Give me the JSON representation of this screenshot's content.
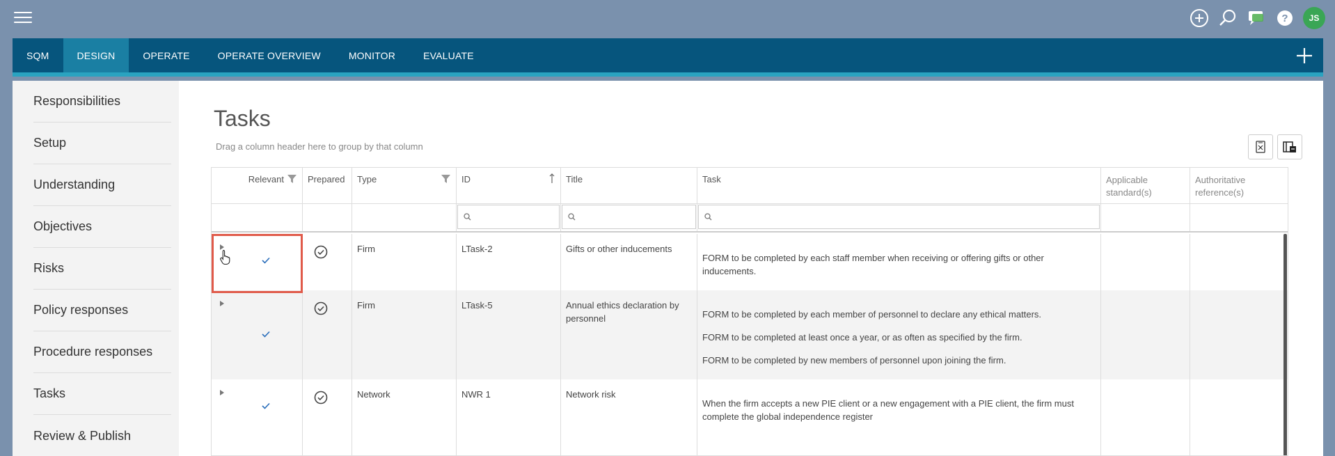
{
  "topbar": {
    "icons": [
      "plus-circle-icon",
      "search-icon",
      "chat-icon",
      "help-icon"
    ],
    "avatar_initials": "JS",
    "avatar_color": "#3aa655"
  },
  "nav": {
    "tabs": [
      {
        "label": "SQM",
        "active": false
      },
      {
        "label": "DESIGN",
        "active": true
      },
      {
        "label": "OPERATE",
        "active": false
      },
      {
        "label": "OPERATE OVERVIEW",
        "active": false
      },
      {
        "label": "MONITOR",
        "active": false
      },
      {
        "label": "EVALUATE",
        "active": false
      }
    ],
    "bar_color": "#06557d",
    "accent_color": "#2aa3c0"
  },
  "sidebar": {
    "items": [
      {
        "label": "Responsibilities"
      },
      {
        "label": "Setup"
      },
      {
        "label": "Understanding"
      },
      {
        "label": "Objectives"
      },
      {
        "label": "Risks"
      },
      {
        "label": "Policy responses"
      },
      {
        "label": "Procedure responses"
      },
      {
        "label": "Tasks"
      },
      {
        "label": "Review & Publish"
      }
    ]
  },
  "main": {
    "title": "Tasks",
    "group_hint": "Drag a column header here to group by that column"
  },
  "grid": {
    "columns": [
      {
        "label": "Relevant"
      },
      {
        "label": "Prepared"
      },
      {
        "label": "Type"
      },
      {
        "label": "ID"
      },
      {
        "label": "Title"
      },
      {
        "label": "Task"
      },
      {
        "label": "Applicable standard(s)"
      },
      {
        "label": "Authoritative reference(s)"
      }
    ],
    "rows": [
      {
        "relevant": true,
        "prepared": true,
        "type": "Firm",
        "id": "LTask-2",
        "title": "Gifts or other inducements",
        "task": [
          "FORM to be completed by each staff member when receiving or offering gifts or other inducements."
        ],
        "standards": "",
        "references": ""
      },
      {
        "relevant": true,
        "prepared": true,
        "type": "Firm",
        "id": "LTask-5",
        "title": "Annual ethics declaration by personnel",
        "task": [
          "FORM to be completed by each member of personnel to declare any ethical matters.",
          "FORM to be completed at least once a year, or as often as specified by the firm.",
          "FORM to be completed by new members of personnel upon joining the firm."
        ],
        "standards": "",
        "references": ""
      },
      {
        "relevant": true,
        "prepared": true,
        "type": "Network",
        "id": "NWR 1",
        "title": "Network risk",
        "task": [
          "When the firm accepts a new PIE client or a new engagement with a PIE client, the firm must complete the global independence register"
        ],
        "standards": "",
        "references": ""
      }
    ],
    "highlight_color": "#e05a4a"
  }
}
